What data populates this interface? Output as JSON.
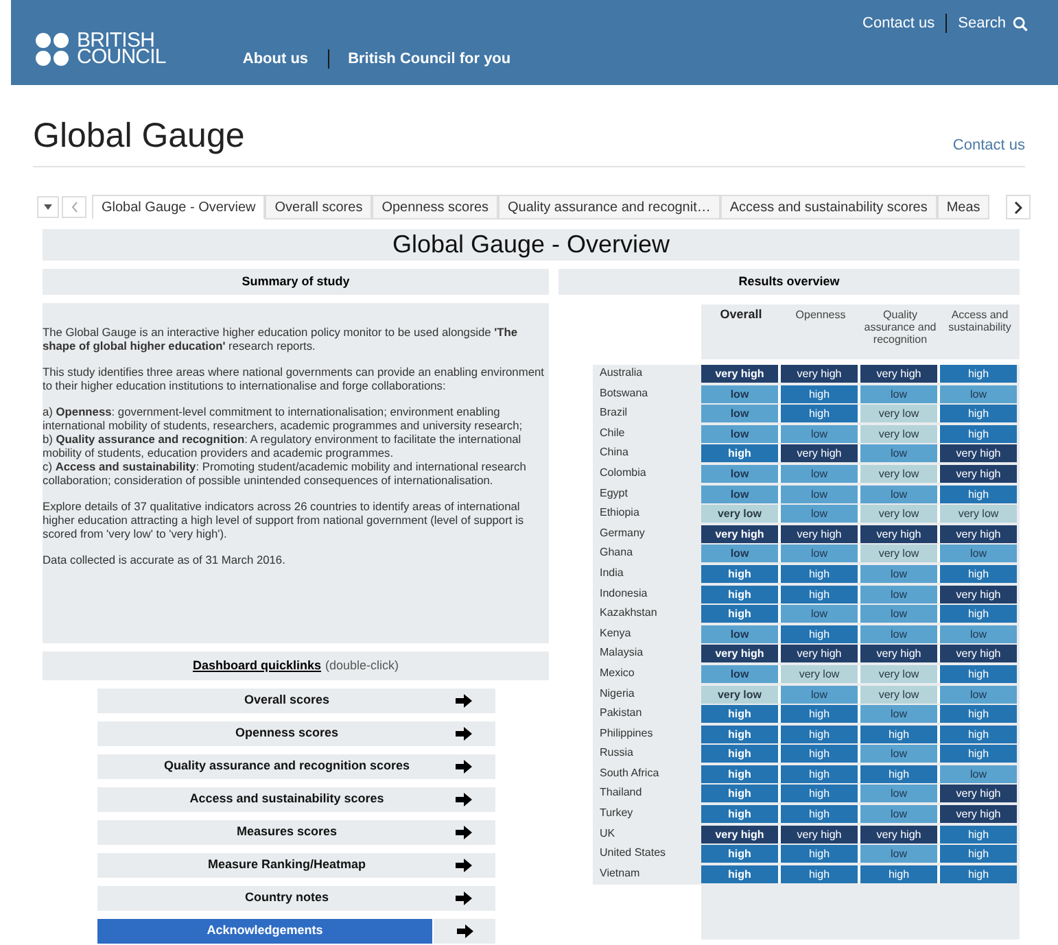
{
  "header": {
    "logo_lines": [
      "BRITISH",
      "COUNCIL"
    ],
    "nav": [
      "About us",
      "British Council for you"
    ],
    "top_links": [
      "Contact us",
      "Search"
    ]
  },
  "page": {
    "title": "Global Gauge",
    "contact_link": "Contact us"
  },
  "tabs": [
    {
      "label": "Global Gauge - Overview",
      "selected": true
    },
    {
      "label": "Overall scores",
      "selected": false
    },
    {
      "label": "Openness scores",
      "selected": false
    },
    {
      "label": "Quality assurance and recognit…",
      "selected": false
    },
    {
      "label": "Access and sustainability scores",
      "selected": false
    },
    {
      "label": "Meas",
      "selected": false
    }
  ],
  "dashboard_title": "Global Gauge - Overview",
  "summary": {
    "heading": "Summary of study",
    "paragraphs": [
      [
        "The Global Gauge is an interactive higher education policy monitor to be used alongside **'The shape of global higher education'** research reports."
      ],
      [
        "This study identifies three areas where national governments can provide an enabling environment to their higher education institutions to internationalise and forge collaborations:"
      ],
      [
        "a) **Openness**: government-level commitment to internationalisation; environment enabling international mobility of students, researchers, academic programmes and university research;",
        "b) **Quality assurance and recognition**: A regulatory environment to facilitate the international mobility of students, education providers and academic programmes.",
        "c) **Access and sustainability**: Promoting student/academic mobility and international research collaboration; consideration of possible unintended consequences of internationalisation."
      ],
      [
        "Explore details of 37 qualitative indicators across 26 countries to identify areas of international higher education attracting a high level of support from national government (level of support is scored from 'very low' to 'very high')."
      ],
      [
        "Data collected is accurate as of 31 March 2016."
      ]
    ]
  },
  "quicklinks": {
    "heading": "Dashboard quicklinks",
    "hint": "(double-click)",
    "items": [
      {
        "label": "Overall scores",
        "selected": false
      },
      {
        "label": "Openness scores",
        "selected": false
      },
      {
        "label": "Quality assurance and recognition scores",
        "selected": false
      },
      {
        "label": "Access and sustainability scores",
        "selected": false
      },
      {
        "label": "Measures scores",
        "selected": false
      },
      {
        "label": "Measure Ranking/Heatmap",
        "selected": false
      },
      {
        "label": "Country notes",
        "selected": false
      },
      {
        "label": "Acknowledgements",
        "selected": true
      }
    ]
  },
  "results": {
    "heading": "Results overview",
    "columns": [
      "Overall",
      "Openness",
      "Quality assurance and recognition",
      "Access and sustainability"
    ],
    "rows": [
      {
        "country": "Australia",
        "scores": [
          {
            "text": "very high",
            "kind": "vh"
          },
          {
            "text": "very high",
            "kind": "vh"
          },
          {
            "text": "very high",
            "kind": "vh"
          },
          {
            "text": "high",
            "kind": "h"
          }
        ]
      },
      {
        "country": "Botswana",
        "scores": [
          {
            "text": "low",
            "kind": "l"
          },
          {
            "text": "high",
            "kind": "h"
          },
          {
            "text": "low",
            "kind": "l"
          },
          {
            "text": "low",
            "kind": "l"
          }
        ]
      },
      {
        "country": "Brazil",
        "scores": [
          {
            "text": "low",
            "kind": "l"
          },
          {
            "text": "high",
            "kind": "h"
          },
          {
            "text": "very low",
            "kind": "vl"
          },
          {
            "text": "high",
            "kind": "h"
          }
        ]
      },
      {
        "country": "Chile",
        "scores": [
          {
            "text": "low",
            "kind": "l"
          },
          {
            "text": "low",
            "kind": "l"
          },
          {
            "text": "very low",
            "kind": "vl"
          },
          {
            "text": "high",
            "kind": "h"
          }
        ]
      },
      {
        "country": "China",
        "scores": [
          {
            "text": "high",
            "kind": "h"
          },
          {
            "text": "very high",
            "kind": "vh"
          },
          {
            "text": "low",
            "kind": "l"
          },
          {
            "text": "very high",
            "kind": "vh"
          }
        ]
      },
      {
        "country": "Colombia",
        "scores": [
          {
            "text": "low",
            "kind": "l"
          },
          {
            "text": "low",
            "kind": "l"
          },
          {
            "text": "very low",
            "kind": "vl"
          },
          {
            "text": "very high",
            "kind": "vh"
          }
        ]
      },
      {
        "country": "Egypt",
        "scores": [
          {
            "text": "low",
            "kind": "l"
          },
          {
            "text": "low",
            "kind": "l"
          },
          {
            "text": "low",
            "kind": "l"
          },
          {
            "text": "high",
            "kind": "h"
          }
        ]
      },
      {
        "country": "Ethiopia",
        "scores": [
          {
            "text": "very low",
            "kind": "vl"
          },
          {
            "text": "low",
            "kind": "l"
          },
          {
            "text": "very low",
            "kind": "vl"
          },
          {
            "text": "very low",
            "kind": "vl"
          }
        ]
      },
      {
        "country": "Germany",
        "scores": [
          {
            "text": "very high",
            "kind": "vh"
          },
          {
            "text": "very high",
            "kind": "vh"
          },
          {
            "text": "very high",
            "kind": "vh"
          },
          {
            "text": "very high",
            "kind": "vh"
          }
        ]
      },
      {
        "country": "Ghana",
        "scores": [
          {
            "text": "low",
            "kind": "l"
          },
          {
            "text": "low",
            "kind": "l"
          },
          {
            "text": "very low",
            "kind": "vl"
          },
          {
            "text": "low",
            "kind": "l"
          }
        ]
      },
      {
        "country": "India",
        "scores": [
          {
            "text": "high",
            "kind": "h"
          },
          {
            "text": "high",
            "kind": "h"
          },
          {
            "text": "low",
            "kind": "l"
          },
          {
            "text": "high",
            "kind": "h"
          }
        ]
      },
      {
        "country": "Indonesia",
        "scores": [
          {
            "text": "high",
            "kind": "h"
          },
          {
            "text": "high",
            "kind": "h"
          },
          {
            "text": "low",
            "kind": "l"
          },
          {
            "text": "very high",
            "kind": "vh"
          }
        ]
      },
      {
        "country": "Kazakhstan",
        "scores": [
          {
            "text": "high",
            "kind": "h"
          },
          {
            "text": "low",
            "kind": "l"
          },
          {
            "text": "low",
            "kind": "l"
          },
          {
            "text": "high",
            "kind": "h"
          }
        ]
      },
      {
        "country": "Kenya",
        "scores": [
          {
            "text": "low",
            "kind": "l"
          },
          {
            "text": "high",
            "kind": "h"
          },
          {
            "text": "low",
            "kind": "l"
          },
          {
            "text": "low",
            "kind": "l"
          }
        ]
      },
      {
        "country": "Malaysia",
        "scores": [
          {
            "text": "very high",
            "kind": "vh"
          },
          {
            "text": "very high",
            "kind": "vh"
          },
          {
            "text": "very high",
            "kind": "vh"
          },
          {
            "text": "very high",
            "kind": "vh"
          }
        ]
      },
      {
        "country": "Mexico",
        "scores": [
          {
            "text": "low",
            "kind": "l"
          },
          {
            "text": "very low",
            "kind": "vl"
          },
          {
            "text": "very low",
            "kind": "vl"
          },
          {
            "text": "high",
            "kind": "h"
          }
        ]
      },
      {
        "country": "Nigeria",
        "scores": [
          {
            "text": "very low",
            "kind": "vl"
          },
          {
            "text": "low",
            "kind": "l"
          },
          {
            "text": "very low",
            "kind": "vl"
          },
          {
            "text": "low",
            "kind": "l"
          }
        ]
      },
      {
        "country": "Pakistan",
        "scores": [
          {
            "text": "high",
            "kind": "h"
          },
          {
            "text": "high",
            "kind": "h"
          },
          {
            "text": "low",
            "kind": "l"
          },
          {
            "text": "high",
            "kind": "h"
          }
        ]
      },
      {
        "country": "Philippines",
        "scores": [
          {
            "text": "high",
            "kind": "h"
          },
          {
            "text": "high",
            "kind": "h"
          },
          {
            "text": "high",
            "kind": "h"
          },
          {
            "text": "high",
            "kind": "h"
          }
        ]
      },
      {
        "country": "Russia",
        "scores": [
          {
            "text": "high",
            "kind": "h"
          },
          {
            "text": "high",
            "kind": "h"
          },
          {
            "text": "low",
            "kind": "l"
          },
          {
            "text": "high",
            "kind": "h"
          }
        ]
      },
      {
        "country": "South Africa",
        "scores": [
          {
            "text": "high",
            "kind": "h"
          },
          {
            "text": "high",
            "kind": "h"
          },
          {
            "text": "high",
            "kind": "h"
          },
          {
            "text": "low",
            "kind": "l"
          }
        ]
      },
      {
        "country": "Thailand",
        "scores": [
          {
            "text": "high",
            "kind": "h"
          },
          {
            "text": "high",
            "kind": "h"
          },
          {
            "text": "low",
            "kind": "l"
          },
          {
            "text": "very high",
            "kind": "vh"
          }
        ]
      },
      {
        "country": "Turkey",
        "scores": [
          {
            "text": "high",
            "kind": "h"
          },
          {
            "text": "high",
            "kind": "h"
          },
          {
            "text": "low",
            "kind": "l"
          },
          {
            "text": "very high",
            "kind": "vh"
          }
        ]
      },
      {
        "country": "UK",
        "scores": [
          {
            "text": "very high",
            "kind": "vh"
          },
          {
            "text": "very high",
            "kind": "vh"
          },
          {
            "text": "very high",
            "kind": "vh"
          },
          {
            "text": "high",
            "kind": "h"
          }
        ]
      },
      {
        "country": "United States",
        "scores": [
          {
            "text": "high",
            "kind": "h"
          },
          {
            "text": "high",
            "kind": "h"
          },
          {
            "text": "low",
            "kind": "l"
          },
          {
            "text": "high",
            "kind": "h"
          }
        ]
      },
      {
        "country": "Vietnam",
        "scores": [
          {
            "text": "high",
            "kind": "h"
          },
          {
            "text": "high",
            "kind": "h"
          },
          {
            "text": "high",
            "kind": "h"
          },
          {
            "text": "high",
            "kind": "h"
          }
        ]
      }
    ]
  }
}
